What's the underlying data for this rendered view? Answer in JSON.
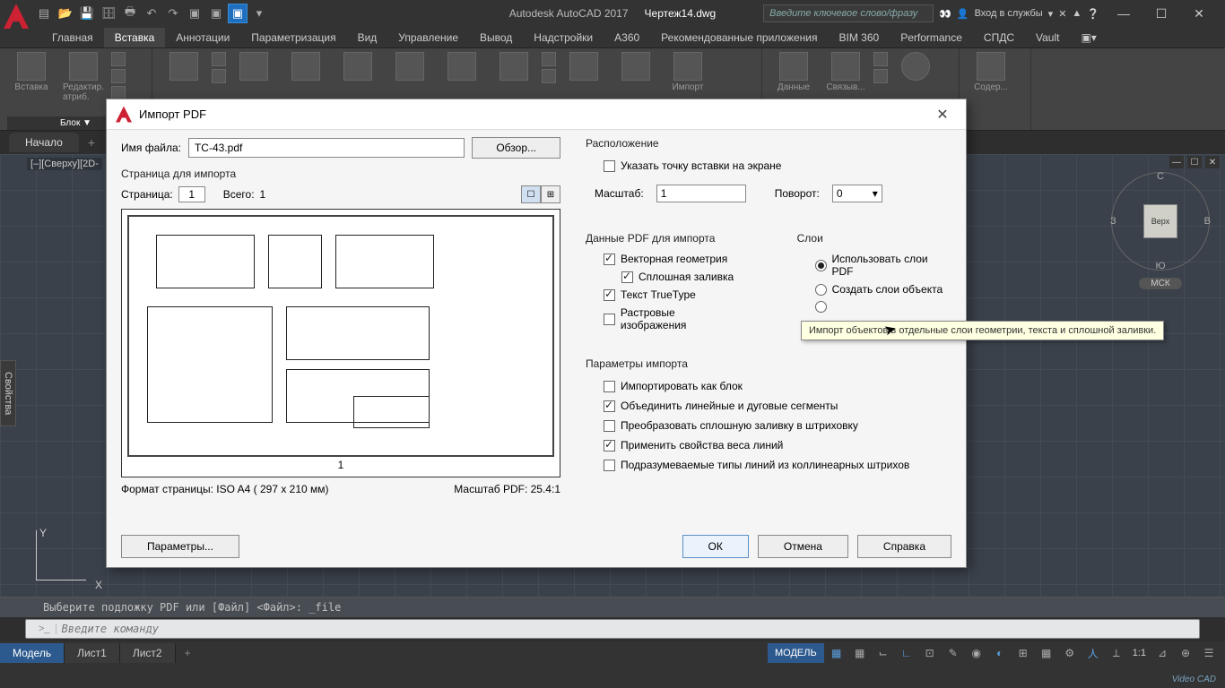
{
  "titlebar": {
    "app_name": "Autodesk AutoCAD 2017",
    "doc_name": "Чертеж14.dwg",
    "search_placeholder": "Введите ключевое слово/фразу",
    "signin": "Вход в службы",
    "min": "—",
    "max": "☐",
    "close": "✕"
  },
  "ribbon": {
    "tabs": [
      "Главная",
      "Вставка",
      "Аннотации",
      "Параметризация",
      "Вид",
      "Управление",
      "Вывод",
      "Надстройки",
      "A360",
      "Рекомендованные приложения",
      "BIM 360",
      "Performance",
      "СПДС",
      "Vault"
    ],
    "active_tab_index": 1,
    "panels": {
      "block": {
        "insert": "Вставка",
        "edit": "Редактир.\nатриб.",
        "title": "Блок ▼"
      },
      "attrib": {
        "title": ""
      },
      "ref": {
        "import": "Импорт",
        "data": "Данные",
        "link": "Связыв...",
        "title": ""
      },
      "content": {
        "title": "Содер..."
      }
    }
  },
  "doctabs": {
    "start": "Начало",
    "plus": "+"
  },
  "viewport": {
    "label": "[–][Сверху][2D-",
    "min": "—",
    "max": "☐",
    "close": "✕",
    "compass": {
      "n": "С",
      "s": "Ю",
      "e": "В",
      "w": "З",
      "top": "Верх"
    },
    "wcs": "МСК",
    "ucs_x": "X",
    "ucs_y": "Y",
    "props_tab": "Свойства"
  },
  "cmdline": {
    "history": "Выберите подложку PDF или [Файл] <Файл>: _file",
    "placeholder": "Введите команду",
    "chevron": ">_"
  },
  "watermark": "Video CAD",
  "status": {
    "layouts": [
      "Модель",
      "Лист1",
      "Лист2"
    ],
    "plus": "+",
    "model": "МОДЕЛЬ",
    "scale": "1:1",
    "icon_glyphs": [
      "▦",
      "▦",
      "⌙",
      "∟",
      "⊡",
      "✎",
      "◉",
      "◐",
      "⊞",
      "▦",
      "⚙",
      "人",
      "⟂",
      "⊿",
      "⊕",
      "☰"
    ]
  },
  "dialog": {
    "title": "Импорт PDF",
    "file": {
      "label": "Имя файла:",
      "value": "TC-43.pdf",
      "browse": "Обзор..."
    },
    "page_section": {
      "label": "Страница для импорта",
      "page_label": "Страница:",
      "page_value": "1",
      "total_label": "Всего:",
      "total_value": "1",
      "preview_num": "1",
      "format": "Формат страницы: ISO A4 ( 297 x  210 мм)",
      "pdfscale": "Масштаб PDF:  25.4:1"
    },
    "location": {
      "label": "Расположение",
      "specify": "Указать точку вставки на экране",
      "scale_label": "Масштаб:",
      "scale_value": "1",
      "rotation_label": "Поворот:",
      "rotation_value": "0"
    },
    "pdfdata": {
      "label": "Данные PDF для импорта",
      "vector": "Векторная геометрия",
      "solid": "Сплошная заливка",
      "ttf": "Текст TrueType",
      "raster": "Растровые изображения"
    },
    "layers": {
      "label": "Слои",
      "use_pdf": "Использовать слои PDF",
      "create_obj": "Создать слои объекта",
      "tooltip": "Импорт объектов в отдельные слои геометрии, текста и сплошной заливки."
    },
    "importopts": {
      "label": "Параметры импорта",
      "as_block": "Импортировать как блок",
      "join": "Объединить линейные и дуговые сегменты",
      "convert_hatch": "Преобразовать сплошную заливку в штриховку",
      "lineweight": "Применить свойства веса линий",
      "infer_ltypes": "Подразумеваемые типы линий из коллинеарных штрихов"
    },
    "footer": {
      "params": "Параметры...",
      "ok": "ОК",
      "cancel": "Отмена",
      "help": "Справка"
    }
  }
}
